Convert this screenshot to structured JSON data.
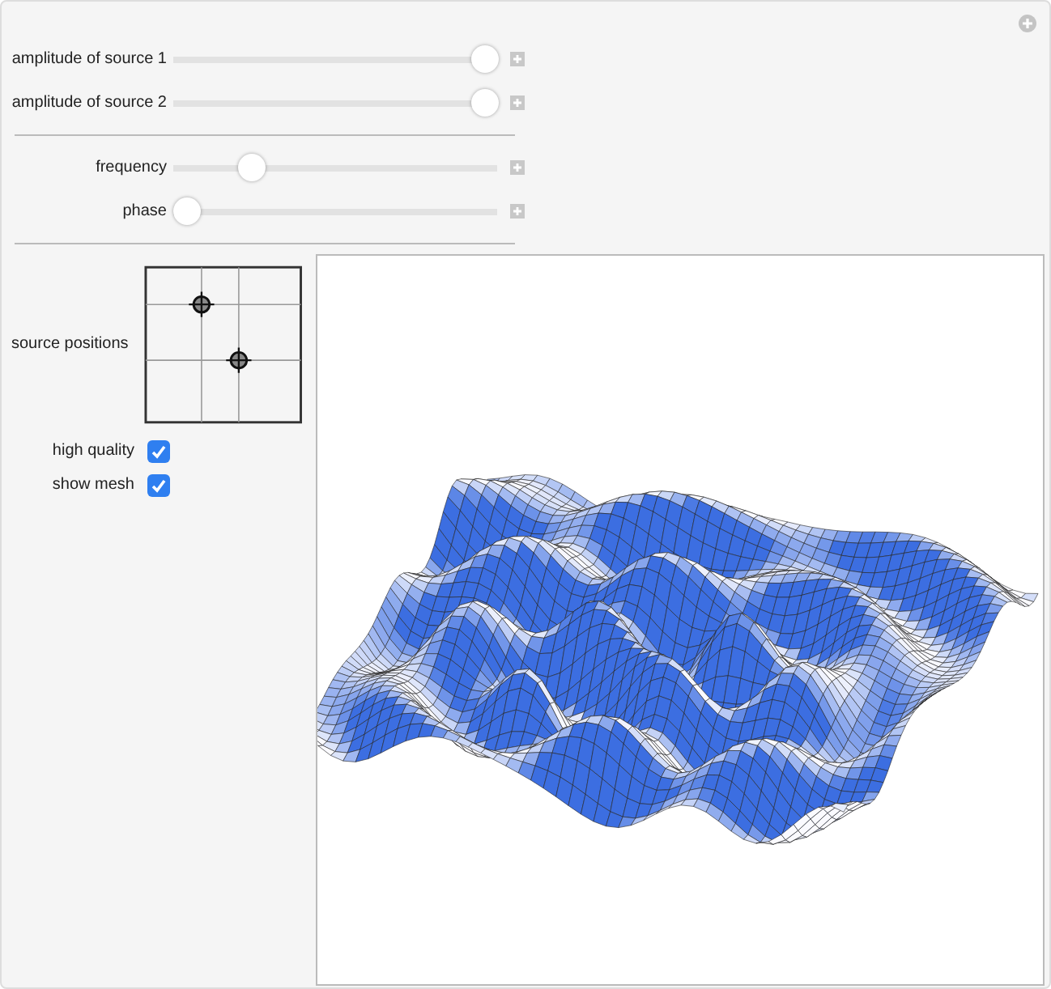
{
  "sliders_top": [
    {
      "label": "amplitude of source 1",
      "level": 1
    },
    {
      "label": "amplitude of source 2",
      "level": 1
    }
  ],
  "sliders_mid": [
    {
      "label": "frequency",
      "level": 0.22
    },
    {
      "label": "phase",
      "level": 0
    }
  ],
  "locator": {
    "label": "source positions",
    "points": [
      {
        "x": {
          "level": 0.36
        },
        "y": {
          "level": 0.76
        }
      },
      {
        "x": {
          "level": 0.6
        },
        "y": {
          "level": 0.4
        }
      }
    ]
  },
  "checkboxes": [
    {
      "label": "high quality",
      "checked": true
    },
    {
      "label": "show mesh",
      "checked": true
    }
  ]
}
